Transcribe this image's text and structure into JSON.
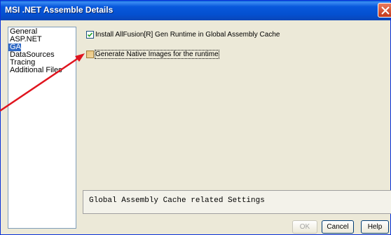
{
  "window": {
    "title": "MSI .NET Assemble Details"
  },
  "nav": {
    "items": [
      {
        "label": "General",
        "selected": false
      },
      {
        "label": "ASP.NET",
        "selected": false
      },
      {
        "label": "GAC",
        "selected": true
      },
      {
        "label": "DataSources",
        "selected": false
      },
      {
        "label": "Tracing",
        "selected": false
      },
      {
        "label": "Additional Files",
        "selected": false
      }
    ]
  },
  "gac": {
    "install_label": "Install AllFusion[R] Gen Runtime in Global Assembly Cache",
    "install_checked": true,
    "native_label": "Generate Native Images for the runtime",
    "native_checked": false
  },
  "info": {
    "text": "Global Assembly Cache related Settings"
  },
  "buttons": {
    "ok": "OK",
    "cancel": "Cancel",
    "help": "Help"
  },
  "colors": {
    "title_bar": "#0858dc",
    "selection": "#316ac5",
    "annotation_arrow": "#e0141e"
  }
}
